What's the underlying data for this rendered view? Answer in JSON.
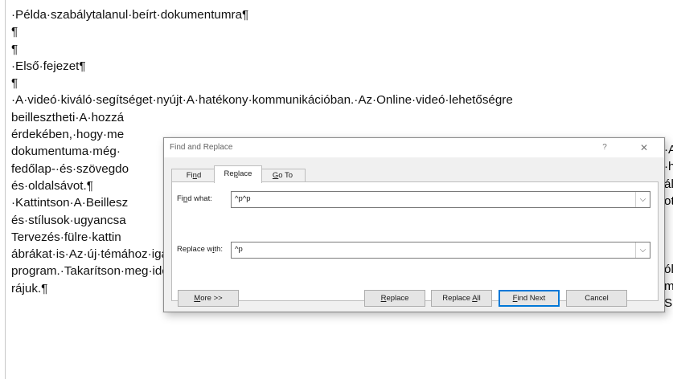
{
  "document": {
    "lines": [
      "·Példa·szabálytalanul·beírt·dokumentumra¶",
      "¶",
      "¶",
      "·Első·fejezet¶",
      "¶",
      "·A·videó·kiváló·segítséget·nyújt·A·hatékony·kommunikációban.·Az·Online·videó·lehetőségre",
      "beillesztheti·A·hozzá",
      "érdekében,·hogy·me",
      "dokumentuma·még·",
      "fedőlap-·és·szövegdo",
      "és·oldalsávot.¶",
      "·Kattintson·A·Beillesz",
      "és·stílusok·ugyancsa",
      "Tervezés·fülre·kattin",
      "ábrákat·is·Az·új·témához·igazítja.·A·stílusok·Alkalmazásakor·A·címsorokat·Az·új·témához·iga",
      "program.·Takarítson·meg·időt·A·Word·új·gombjaival,·melyek·ott·jelennek·meg,·Ahol·épp·szü",
      "rájuk.¶"
    ],
    "right_fragments": [
      {
        "row": 6,
        "text": "·A"
      },
      {
        "row": 7,
        "text": "·h"
      },
      {
        "row": 8,
        "text": "ál"
      },
      {
        "row": 9,
        "text": "ot"
      },
      {
        "row": 11,
        "text": "ól"
      },
      {
        "row": 12,
        "text": "m"
      },
      {
        "row": 13,
        "text": "Sn"
      }
    ]
  },
  "dialog": {
    "title": "Find and Replace",
    "help": "?",
    "close": "✕",
    "tabs": {
      "find": {
        "pre": "Fi",
        "key": "n",
        "post": "d"
      },
      "replace": {
        "pre": "Re",
        "key": "p",
        "post": "lace"
      },
      "goto": {
        "pre": "",
        "key": "G",
        "post": "o To"
      }
    },
    "find_label": {
      "pre": "Fi",
      "key": "n",
      "post": "d what:"
    },
    "find_value": "^p^p",
    "replace_label": {
      "pre": "Replace w",
      "key": "i",
      "post": "th:"
    },
    "replace_value": "^p",
    "dropdown_glyph": "⌵",
    "buttons": {
      "more": {
        "pre": "",
        "key": "M",
        "post": "ore >>"
      },
      "replace": {
        "pre": "",
        "key": "R",
        "post": "eplace"
      },
      "replace_all": {
        "pre": "Replace ",
        "key": "A",
        "post": "ll"
      },
      "find_next": {
        "pre": "",
        "key": "F",
        "post": "ind Next"
      },
      "cancel": "Cancel"
    }
  }
}
